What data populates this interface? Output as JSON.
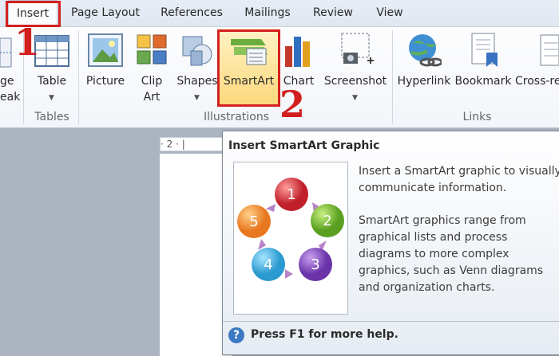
{
  "tabs": [
    "Insert",
    "Page Layout",
    "References",
    "Mailings",
    "Review",
    "View"
  ],
  "ribbon": {
    "left_partial": [
      "ge",
      "eak"
    ],
    "tables": {
      "table_label": "Table",
      "group_label": "Tables"
    },
    "illustrations": {
      "picture": "Picture",
      "clip_line1": "Clip",
      "clip_line2": "Art",
      "shapes": "Shapes",
      "smartart": "SmartArt",
      "chart": "Chart",
      "screenshot": "Screenshot",
      "group_label": "Illustrations"
    },
    "links": {
      "hyperlink": "Hyperlink",
      "bookmark": "Bookmark",
      "crossref": "Cross-re",
      "group_label": "Links"
    }
  },
  "annotations": {
    "step1": "1",
    "step2": "2"
  },
  "ruler": {
    "text": "· 2 · |"
  },
  "tooltip": {
    "title": "Insert SmartArt Graphic",
    "para1_l1": "Insert a SmartArt graphic to visually",
    "para1_l2": "communicate information.",
    "para2_l1": "SmartArt graphics range from",
    "para2_l2": "graphical lists and process",
    "para2_l3": "diagrams to more complex",
    "para2_l4": "graphics, such as Venn diagrams",
    "para2_l5": "and organization charts.",
    "help": "Press F1 for more help.",
    "cycle_numbers": [
      "1",
      "2",
      "3",
      "4",
      "5"
    ]
  },
  "colors": {
    "accent_red": "#d42020",
    "tooltip_highlight": "#fbe38d"
  }
}
